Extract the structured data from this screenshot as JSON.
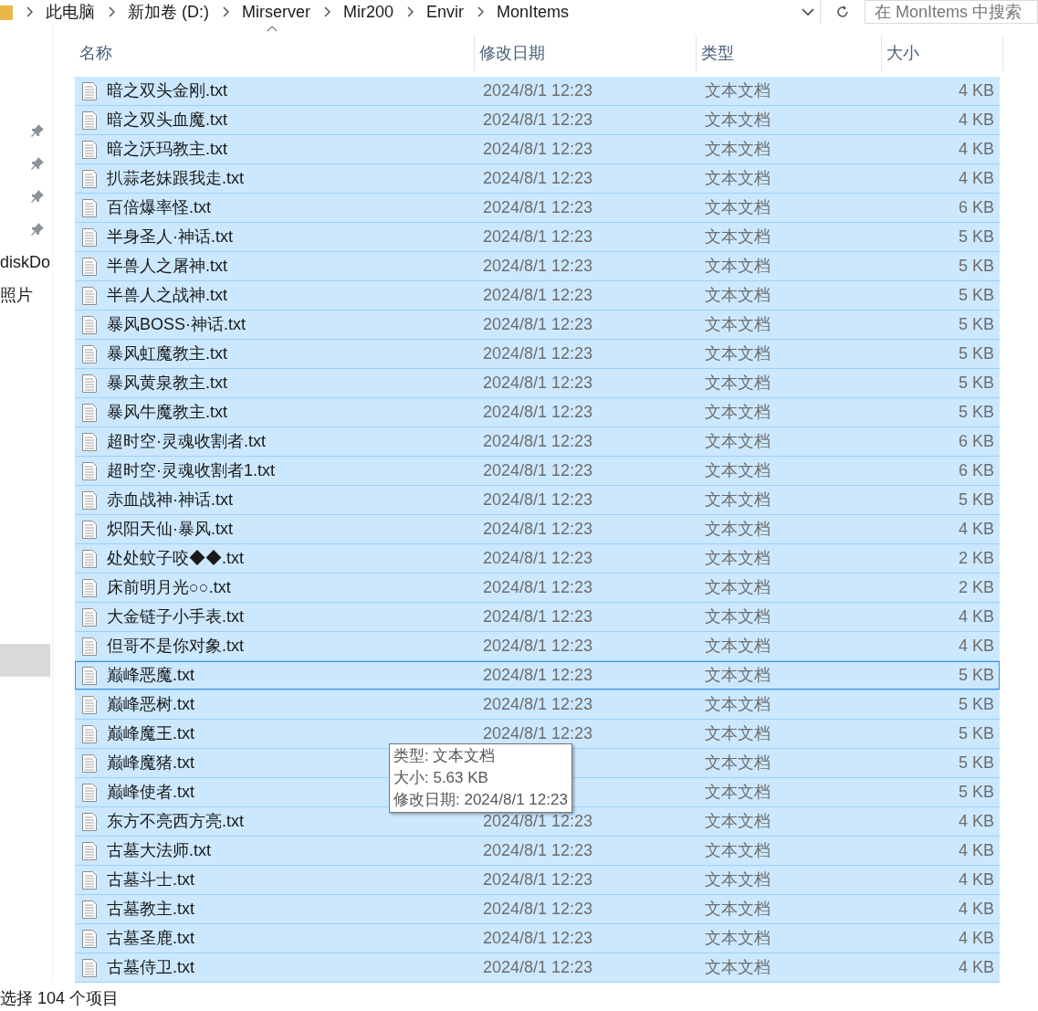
{
  "breadcrumb": [
    "此电脑",
    "新加卷 (D:)",
    "Mirserver",
    "Mir200",
    "Envir",
    "MonItems"
  ],
  "search": {
    "placeholder": "在 MonItems 中搜索"
  },
  "sidebar": {
    "items": [
      {
        "kind": "pin"
      },
      {
        "kind": "pin"
      },
      {
        "kind": "pin"
      },
      {
        "kind": "pin"
      },
      {
        "kind": "text",
        "label": "diskDo"
      },
      {
        "kind": "text",
        "label": "照片"
      },
      {
        "kind": "highlight",
        "selected": true
      }
    ]
  },
  "columns": [
    {
      "label": "名称",
      "sorted": true
    },
    {
      "label": "修改日期",
      "sorted": false
    },
    {
      "label": "类型",
      "sorted": false
    },
    {
      "label": "大小",
      "sorted": false
    }
  ],
  "rows": [
    {
      "name": "暗之双头金刚.txt",
      "modified": "2024/8/1 12:23",
      "type": "文本文档",
      "size": "4 KB",
      "selected": true,
      "focused": false
    },
    {
      "name": "暗之双头血魔.txt",
      "modified": "2024/8/1 12:23",
      "type": "文本文档",
      "size": "4 KB",
      "selected": true,
      "focused": false
    },
    {
      "name": "暗之沃玛教主.txt",
      "modified": "2024/8/1 12:23",
      "type": "文本文档",
      "size": "4 KB",
      "selected": true,
      "focused": false
    },
    {
      "name": "扒蒜老妹跟我走.txt",
      "modified": "2024/8/1 12:23",
      "type": "文本文档",
      "size": "4 KB",
      "selected": true,
      "focused": false
    },
    {
      "name": "百倍爆率怪.txt",
      "modified": "2024/8/1 12:23",
      "type": "文本文档",
      "size": "6 KB",
      "selected": true,
      "focused": false
    },
    {
      "name": "半身圣人·神话.txt",
      "modified": "2024/8/1 12:23",
      "type": "文本文档",
      "size": "5 KB",
      "selected": true,
      "focused": false
    },
    {
      "name": "半兽人之屠神.txt",
      "modified": "2024/8/1 12:23",
      "type": "文本文档",
      "size": "5 KB",
      "selected": true,
      "focused": false
    },
    {
      "name": "半兽人之战神.txt",
      "modified": "2024/8/1 12:23",
      "type": "文本文档",
      "size": "5 KB",
      "selected": true,
      "focused": false
    },
    {
      "name": "暴风BOSS·神话.txt",
      "modified": "2024/8/1 12:23",
      "type": "文本文档",
      "size": "5 KB",
      "selected": true,
      "focused": false
    },
    {
      "name": "暴风虹魔教主.txt",
      "modified": "2024/8/1 12:23",
      "type": "文本文档",
      "size": "5 KB",
      "selected": true,
      "focused": false
    },
    {
      "name": "暴风黄泉教主.txt",
      "modified": "2024/8/1 12:23",
      "type": "文本文档",
      "size": "5 KB",
      "selected": true,
      "focused": false
    },
    {
      "name": "暴风牛魔教主.txt",
      "modified": "2024/8/1 12:23",
      "type": "文本文档",
      "size": "5 KB",
      "selected": true,
      "focused": false
    },
    {
      "name": "超时空·灵魂收割者.txt",
      "modified": "2024/8/1 12:23",
      "type": "文本文档",
      "size": "6 KB",
      "selected": true,
      "focused": false
    },
    {
      "name": "超时空·灵魂收割者1.txt",
      "modified": "2024/8/1 12:23",
      "type": "文本文档",
      "size": "6 KB",
      "selected": true,
      "focused": false
    },
    {
      "name": "赤血战神·神话.txt",
      "modified": "2024/8/1 12:23",
      "type": "文本文档",
      "size": "5 KB",
      "selected": true,
      "focused": false
    },
    {
      "name": "炽阳天仙·暴风.txt",
      "modified": "2024/8/1 12:23",
      "type": "文本文档",
      "size": "4 KB",
      "selected": true,
      "focused": false
    },
    {
      "name": "处处蚊子咬◆◆.txt",
      "modified": "2024/8/1 12:23",
      "type": "文本文档",
      "size": "2 KB",
      "selected": true,
      "focused": false
    },
    {
      "name": "床前明月光○○.txt",
      "modified": "2024/8/1 12:23",
      "type": "文本文档",
      "size": "2 KB",
      "selected": true,
      "focused": false
    },
    {
      "name": "大金链子小手表.txt",
      "modified": "2024/8/1 12:23",
      "type": "文本文档",
      "size": "4 KB",
      "selected": true,
      "focused": false
    },
    {
      "name": "但哥不是你对象.txt",
      "modified": "2024/8/1 12:23",
      "type": "文本文档",
      "size": "4 KB",
      "selected": true,
      "focused": false
    },
    {
      "name": "巅峰恶魔.txt",
      "modified": "2024/8/1 12:23",
      "type": "文本文档",
      "size": "5 KB",
      "selected": true,
      "focused": true
    },
    {
      "name": "巅峰恶树.txt",
      "modified": "2024/8/1 12:23",
      "type": "文本文档",
      "size": "5 KB",
      "selected": true,
      "focused": false
    },
    {
      "name": "巅峰魔王.txt",
      "modified": "2024/8/1 12:23",
      "type": "文本文档",
      "size": "5 KB",
      "selected": true,
      "focused": false
    },
    {
      "name": "巅峰魔猪.txt",
      "type": "文本文档",
      "size": "5 KB",
      "selected": true,
      "focused": false
    },
    {
      "name": "巅峰使者.txt",
      "type": "文本文档",
      "size": "5 KB",
      "selected": true,
      "focused": false
    },
    {
      "name": "东方不亮西方亮.txt",
      "modified": "2024/8/1 12:23",
      "type": "文本文档",
      "size": "4 KB",
      "selected": true,
      "focused": false
    },
    {
      "name": "古墓大法师.txt",
      "modified": "2024/8/1 12:23",
      "type": "文本文档",
      "size": "4 KB",
      "selected": true,
      "focused": false
    },
    {
      "name": "古墓斗士.txt",
      "modified": "2024/8/1 12:23",
      "type": "文本文档",
      "size": "4 KB",
      "selected": true,
      "focused": false
    },
    {
      "name": "古墓教主.txt",
      "modified": "2024/8/1 12:23",
      "type": "文本文档",
      "size": "4 KB",
      "selected": true,
      "focused": false
    },
    {
      "name": "古墓圣鹿.txt",
      "modified": "2024/8/1 12:23",
      "type": "文本文档",
      "size": "4 KB",
      "selected": true,
      "focused": false
    },
    {
      "name": "古墓侍卫.txt",
      "modified": "2024/8/1 12:23",
      "type": "文本文档",
      "size": "4 KB",
      "selected": true,
      "focused": false
    }
  ],
  "tooltip": {
    "lines": [
      "类型: 文本文档",
      "大小: 5.63 KB",
      "修改日期: 2024/8/1 12:23"
    ]
  },
  "status_bar": {
    "text": "选择 104 个项目"
  }
}
